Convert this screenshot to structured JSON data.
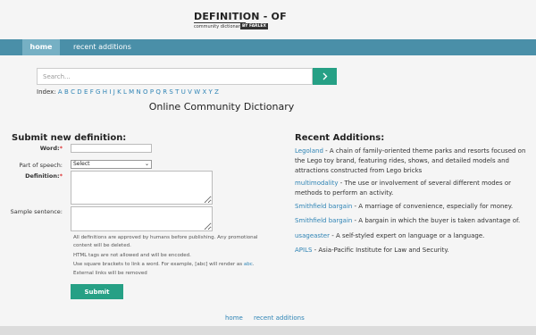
{
  "logo": {
    "main": "DEFINITION - OF",
    "sub": "community dictionary",
    "badge": "BY FARLEX"
  },
  "nav": {
    "home": "home",
    "recent": "recent additions"
  },
  "search": {
    "placeholder": "Search..."
  },
  "index": {
    "label": "Index:",
    "letters": [
      "A",
      "B",
      "C",
      "D",
      "E",
      "F",
      "G",
      "H",
      "I",
      "J",
      "K",
      "L",
      "M",
      "N",
      "O",
      "P",
      "Q",
      "R",
      "S",
      "T",
      "U",
      "V",
      "W",
      "X",
      "Y",
      "Z"
    ]
  },
  "site_title": "Online Community Dictionary",
  "form": {
    "heading": "Submit new definition:",
    "word_label": "Word:",
    "pos_label": "Part of speech:",
    "pos_selected": "Select",
    "definition_label": "Definition:",
    "sample_label": "Sample sentence:",
    "required_mark": "*",
    "notes": [
      "All definitions are approved by humans before publishing. Any promotional",
      "content will be deleted.",
      "HTML tags are not allowed and will be encoded.",
      "Use square brackets to link a word. For example, [abc] will render as",
      "External links will be removed"
    ],
    "note_link": "abc",
    "note_link_suffix": ".",
    "submit": "Submit"
  },
  "recent": {
    "heading": "Recent Additions:",
    "items": [
      {
        "term": "Legoland",
        "desc": " - A chain of family-oriented theme parks and resorts focused on the Lego toy brand, featuring rides, shows, and detailed models and attractions constructed from Lego bricks"
      },
      {
        "term": "multimodality",
        "desc": " - The use or involvement of several different modes or methods to perform an activity."
      },
      {
        "term": "Smithfield bargain",
        "desc": " - A marriage of convenience, especially for money."
      },
      {
        "term": "Smithfield bargain",
        "desc": " - A bargain in which the buyer is taken advantage of."
      },
      {
        "term": "usageaster",
        "desc": " - A self-styled expert on language or a language."
      },
      {
        "term": "APILS",
        "desc": " - Asia-Pacific Institute for Law and Security."
      }
    ]
  },
  "footer": {
    "home": "home",
    "recent": "recent additions"
  },
  "colors": {
    "nav": "#4a8fa8",
    "accent": "#26a085",
    "link": "#2f84b5"
  },
  "icons": {
    "search_button": "chevron-right-icon",
    "select_arrow": "chevron-down-icon"
  }
}
